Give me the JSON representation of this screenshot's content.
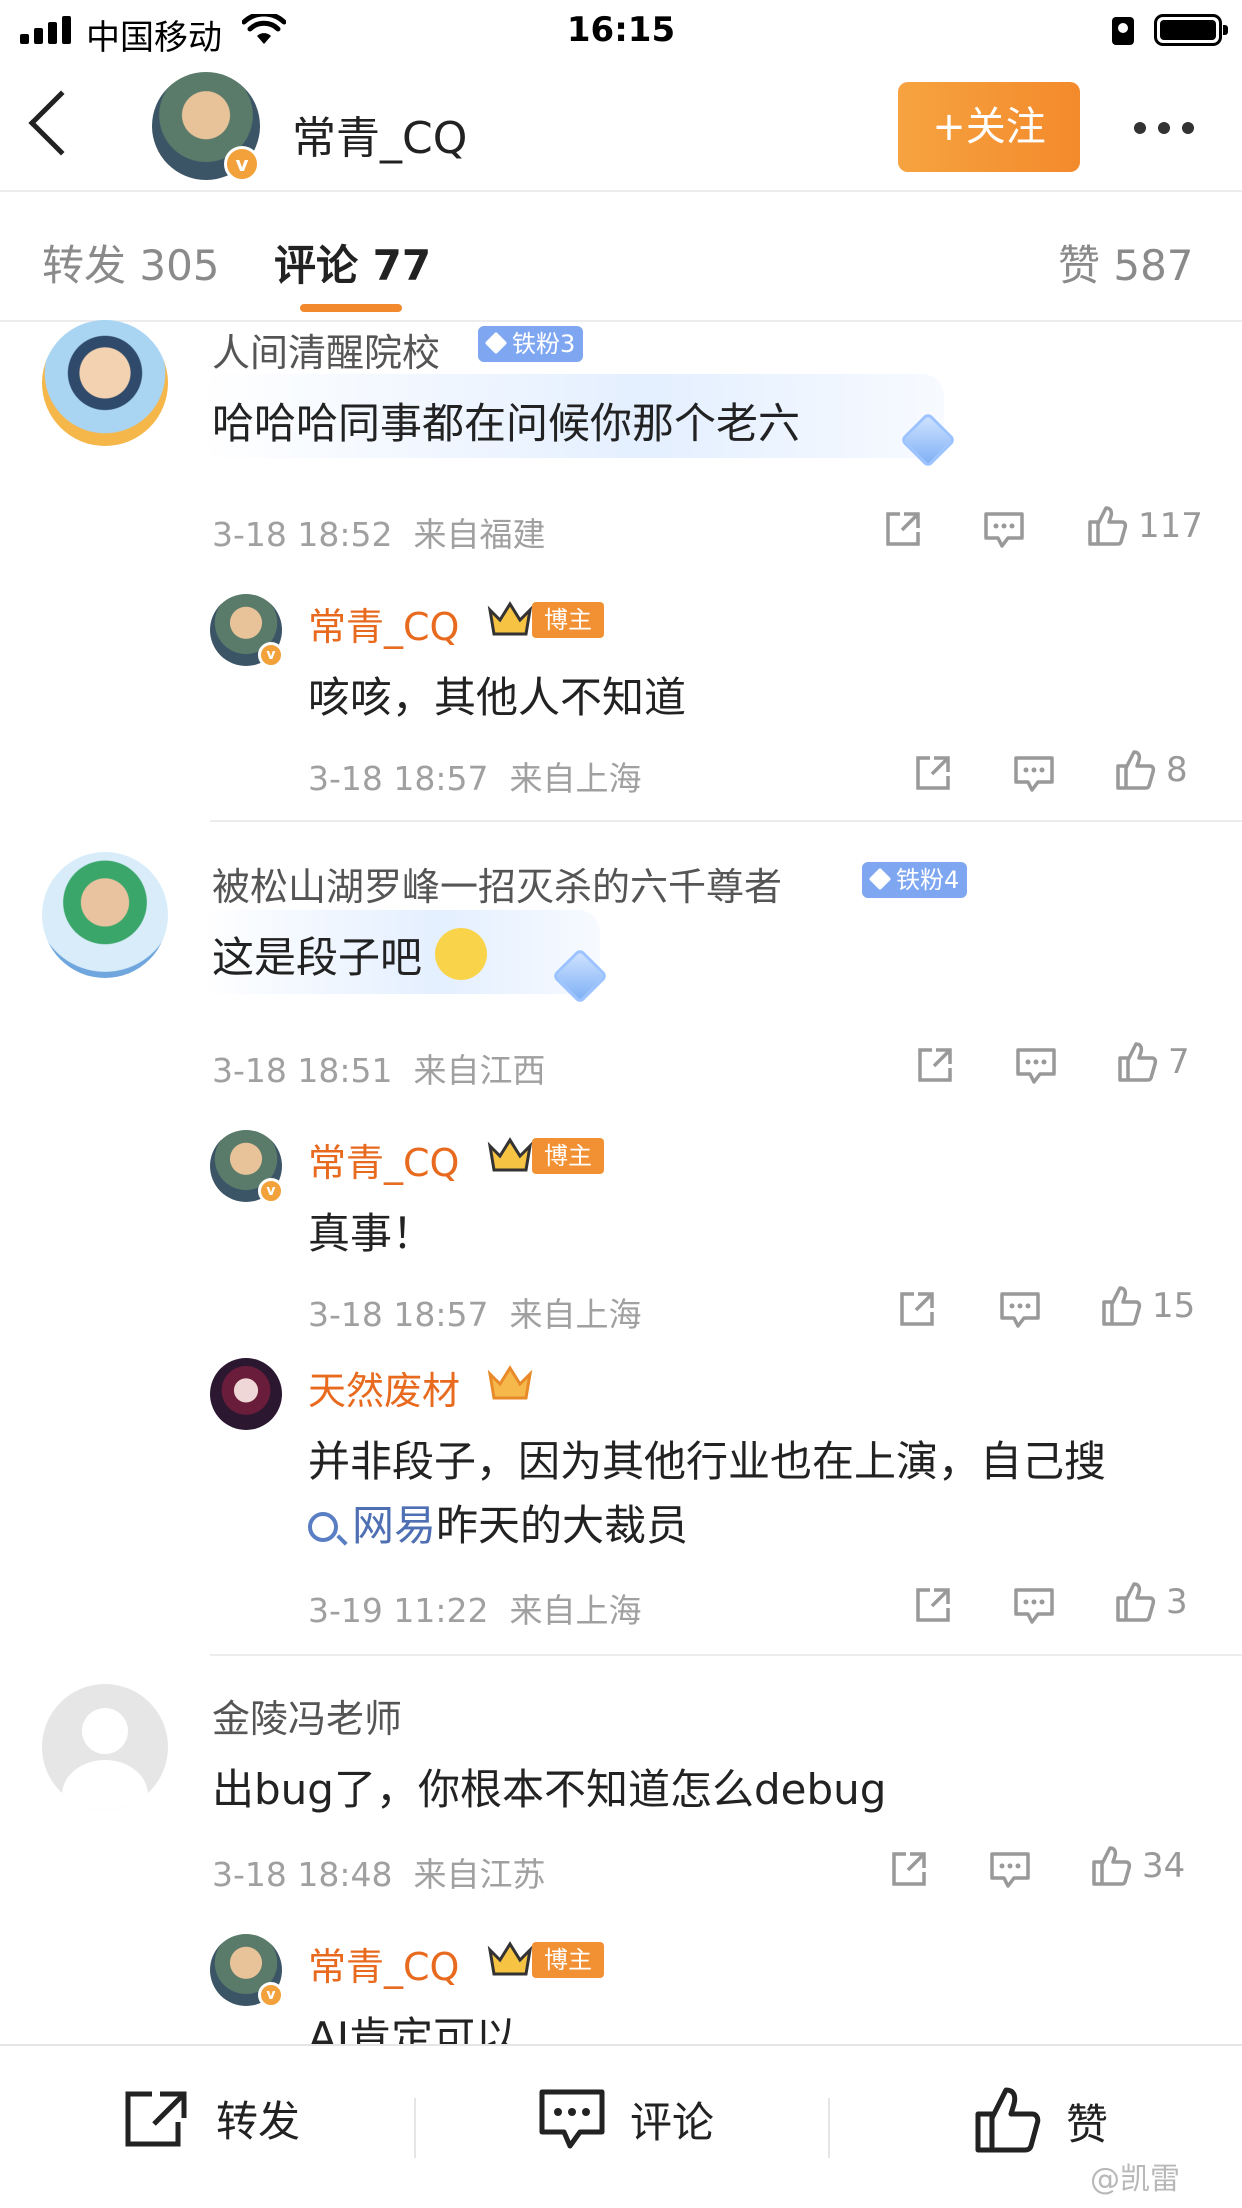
{
  "status_bar": {
    "carrier": "中国移动",
    "time": "16:15"
  },
  "nav": {
    "username": "常青_CQ",
    "follow_label": "+关注"
  },
  "tabs": {
    "repost": "转发 305",
    "comments": "评论 77",
    "likes": "赞 587"
  },
  "comments": [
    {
      "name": "人间清醒院校",
      "fan_badge": "铁粉3",
      "text": "哈哈哈同事都在问候你那个老六",
      "time": "3-18 18:52",
      "location": "来自福建",
      "likes": "117",
      "replies": [
        {
          "name": "常青_CQ",
          "badge": "博主",
          "text": "咳咳，其他人不知道",
          "time": "3-18 18:57",
          "location": "来自上海",
          "likes": "8"
        }
      ]
    },
    {
      "name": "被松山湖罗峰一招灭杀的六千尊者",
      "fan_badge": "铁粉4",
      "text": "这是段子吧",
      "time": "3-18 18:51",
      "location": "来自江西",
      "likes": "7",
      "replies": [
        {
          "name": "常青_CQ",
          "badge": "博主",
          "text": "真事！",
          "time": "3-18 18:57",
          "location": "来自上海",
          "likes": "15"
        },
        {
          "name": "天然废材",
          "text_line1": "并非段子，因为其他行业也在上演，自己搜",
          "link": "网易",
          "text_line2": "昨天的大裁员",
          "time": "3-19 11:22",
          "location": "来自上海",
          "likes": "3"
        }
      ]
    },
    {
      "name": "金陵冯老师",
      "text": "出bug了，你根本不知道怎么debug",
      "time": "3-18 18:48",
      "location": "来自江苏",
      "likes": "34",
      "replies": [
        {
          "name": "常青_CQ",
          "badge": "博主",
          "text": "AI肯定可以"
        }
      ]
    }
  ],
  "bottom_bar": {
    "repost": "转发",
    "comment": "评论",
    "like": "赞"
  },
  "watermark": "@凯雷",
  "colors": {
    "accent": "#f38a2c",
    "owner_name": "#e86a1e",
    "fan_badge": "#7fa7f1",
    "link": "#4e6fb2"
  },
  "icons": [
    "share-icon",
    "comment-icon",
    "like-icon",
    "back-icon",
    "more-icon",
    "search-icon",
    "crown-icon",
    "diamond-icon"
  ]
}
